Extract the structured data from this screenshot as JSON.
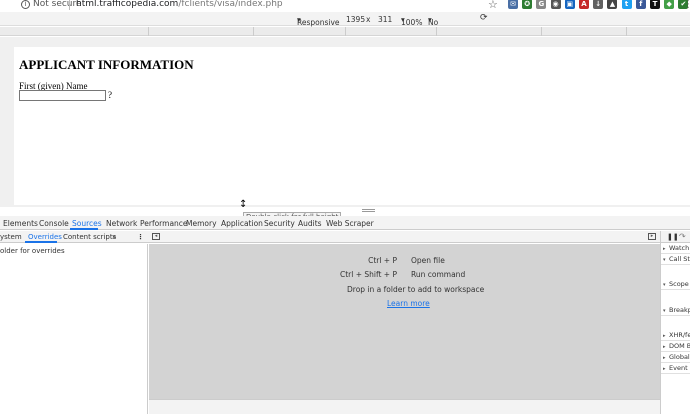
{
  "browser": {
    "security_label": "Not secure",
    "url_host": "html.trafficopedia.com",
    "url_path": "/fclients/visa/index.php",
    "extensions": [
      {
        "name": "extension-1",
        "glyph": "✉",
        "color": "#4a6fa5"
      },
      {
        "name": "extension-2",
        "glyph": "✪",
        "color": "#2e7d32"
      },
      {
        "name": "extension-3",
        "glyph": "G",
        "color": "#888888"
      },
      {
        "name": "extension-4",
        "glyph": "◉",
        "color": "#555555"
      },
      {
        "name": "extension-5",
        "glyph": "▣",
        "color": "#1565c0"
      },
      {
        "name": "extension-6",
        "glyph": "A",
        "color": "#c62828"
      },
      {
        "name": "extension-7",
        "glyph": "↓",
        "color": "#616161"
      },
      {
        "name": "extension-8",
        "glyph": "▲",
        "color": "#444444"
      },
      {
        "name": "extension-9",
        "glyph": "t",
        "color": "#1da1f2"
      },
      {
        "name": "extension-10",
        "glyph": "f",
        "color": "#3b5998"
      },
      {
        "name": "extension-11",
        "glyph": "T",
        "color": "#111111"
      },
      {
        "name": "extension-12",
        "glyph": "◆",
        "color": "#43a047"
      },
      {
        "name": "extension-13",
        "glyph": "✔",
        "color": "#2e7d32"
      }
    ]
  },
  "device_toolbar": {
    "device": "Responsive",
    "width": "1395",
    "times": "x",
    "height": "311",
    "zoom": "100%",
    "throttle": "No throttling"
  },
  "page": {
    "title": "APPLICANT INFORMATION",
    "first_name_label": "First (given) Name",
    "first_name_value": "",
    "help_mark": "?"
  },
  "resize_tooltip": "Double-click for full height",
  "devtools": {
    "tabs": [
      "Elements",
      "Console",
      "Sources",
      "Network",
      "Performance",
      "Memory",
      "Application",
      "Security",
      "Audits",
      "Web Scraper"
    ],
    "active_tab": "Sources",
    "sources_subtabs": [
      "ystem",
      "Overrides",
      "Content scripts",
      "»"
    ],
    "active_subtab": "Overrides",
    "left_pane_text": "older for overrides",
    "shortcuts": [
      {
        "keys": "Ctrl + P",
        "action": "Open file"
      },
      {
        "keys": "Ctrl + Shift + P",
        "action": "Run command"
      }
    ],
    "drop_text": "Drop in a folder to add to workspace",
    "learn_more": "Learn more",
    "right_sections": [
      "Watch",
      "Call Sta",
      "Scope",
      "Breakpo",
      "XHR/fet",
      "DOM B",
      "Global l",
      "Event Li"
    ]
  }
}
